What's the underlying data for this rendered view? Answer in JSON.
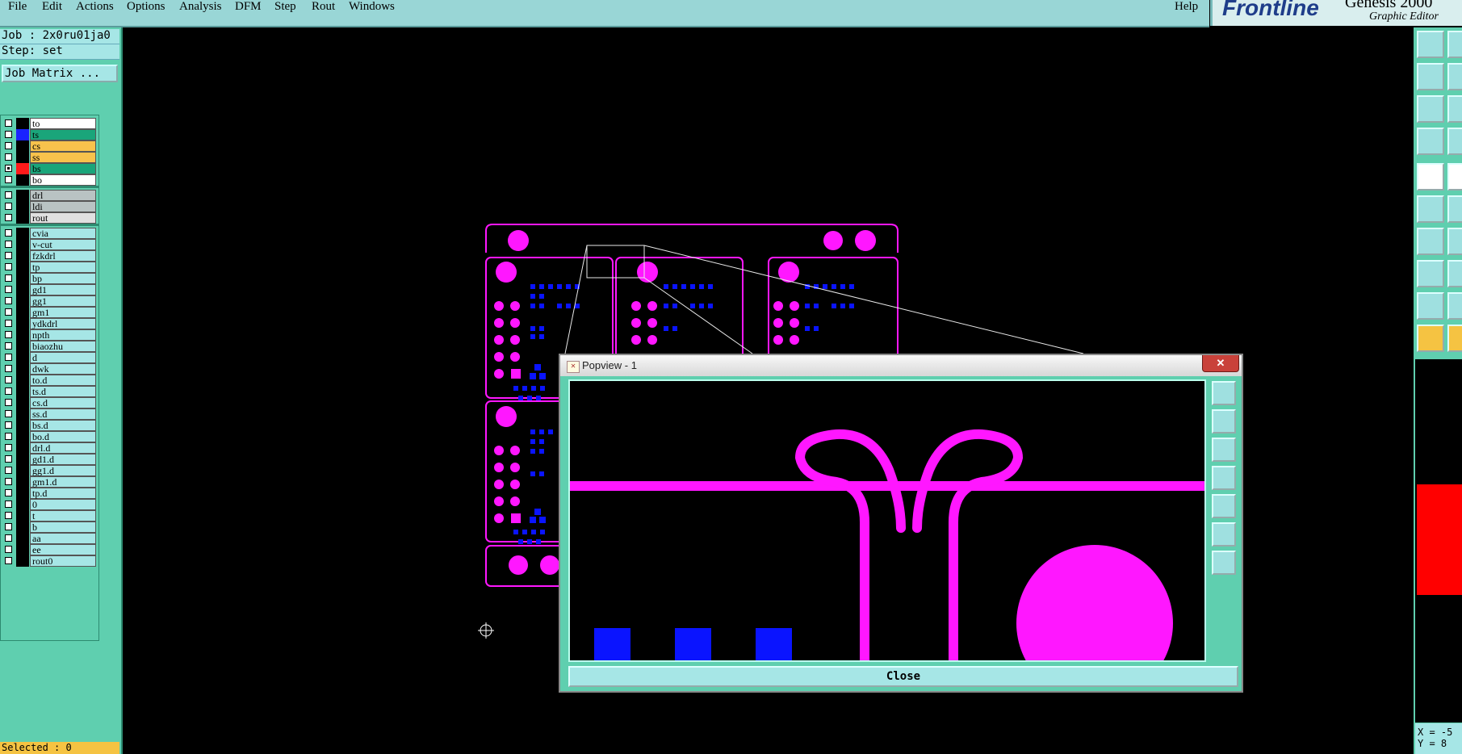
{
  "menubar": {
    "items": [
      "File",
      "Edit",
      "Actions",
      "Options",
      "Analysis",
      "DFM",
      "Step",
      "Rout",
      "Windows"
    ],
    "help": "Help"
  },
  "brand": {
    "logo": "Frontline",
    "title": "Genesis 2000",
    "subtitle": "Graphic Editor"
  },
  "job": {
    "job_line": "Job : 2x0ru01ja0",
    "step_line": "Step: set",
    "matrix_button": "Job Matrix ..."
  },
  "layers": [
    {
      "name": "to",
      "bg": "#ffffff",
      "color": "#000000",
      "checked": false
    },
    {
      "name": "ts",
      "bg": "#1aa57a",
      "color": "#1a23ff",
      "checked": false
    },
    {
      "name": "cs",
      "bg": "#f8c24c",
      "color": "#000000",
      "checked": false
    },
    {
      "name": "ss",
      "bg": "#f8c24c",
      "color": "#000000",
      "checked": false
    },
    {
      "name": "bs",
      "bg": "#1aa57a",
      "color": "#ff1a1a",
      "checked": true
    },
    {
      "name": "bo",
      "bg": "#ffffff",
      "color": "#000000",
      "checked": false
    },
    {
      "name": "drl",
      "bg": "#b9c3c3",
      "color": "#000000",
      "checked": false
    },
    {
      "name": "ldi",
      "bg": "#b9c3c3",
      "color": "#000000",
      "checked": false
    },
    {
      "name": "rout",
      "bg": "#e0e0e0",
      "color": "#000000",
      "checked": false
    },
    {
      "name": "cvia",
      "bg": "#a6e6e6",
      "color": "#000000",
      "checked": false
    },
    {
      "name": "v-cut",
      "bg": "#a6e6e6",
      "color": "#000000",
      "checked": false
    },
    {
      "name": "fzkdrl",
      "bg": "#a6e6e6",
      "color": "#000000",
      "checked": false
    },
    {
      "name": "tp",
      "bg": "#a6e6e6",
      "color": "#000000",
      "checked": false
    },
    {
      "name": "bp",
      "bg": "#a6e6e6",
      "color": "#000000",
      "checked": false
    },
    {
      "name": "gd1",
      "bg": "#a6e6e6",
      "color": "#000000",
      "checked": false
    },
    {
      "name": "gg1",
      "bg": "#a6e6e6",
      "color": "#000000",
      "checked": false
    },
    {
      "name": "gm1",
      "bg": "#a6e6e6",
      "color": "#000000",
      "checked": false
    },
    {
      "name": "ydkdrl",
      "bg": "#a6e6e6",
      "color": "#000000",
      "checked": false
    },
    {
      "name": "npth",
      "bg": "#a6e6e6",
      "color": "#000000",
      "checked": false
    },
    {
      "name": "biaozhu",
      "bg": "#a6e6e6",
      "color": "#000000",
      "checked": false
    },
    {
      "name": "d",
      "bg": "#a6e6e6",
      "color": "#000000",
      "checked": false
    },
    {
      "name": "dwk",
      "bg": "#a6e6e6",
      "color": "#000000",
      "checked": false
    },
    {
      "name": "to.d",
      "bg": "#a6e6e6",
      "color": "#000000",
      "checked": false
    },
    {
      "name": "ts.d",
      "bg": "#a6e6e6",
      "color": "#000000",
      "checked": false
    },
    {
      "name": "cs.d",
      "bg": "#a6e6e6",
      "color": "#000000",
      "checked": false
    },
    {
      "name": "ss.d",
      "bg": "#a6e6e6",
      "color": "#000000",
      "checked": false
    },
    {
      "name": "bs.d",
      "bg": "#a6e6e6",
      "color": "#000000",
      "checked": false
    },
    {
      "name": "bo.d",
      "bg": "#a6e6e6",
      "color": "#000000",
      "checked": false
    },
    {
      "name": "drl.d",
      "bg": "#a6e6e6",
      "color": "#000000",
      "checked": false
    },
    {
      "name": "gd1.d",
      "bg": "#a6e6e6",
      "color": "#000000",
      "checked": false
    },
    {
      "name": "gg1.d",
      "bg": "#a6e6e6",
      "color": "#000000",
      "checked": false
    },
    {
      "name": "gm1.d",
      "bg": "#a6e6e6",
      "color": "#000000",
      "checked": false
    },
    {
      "name": "tp.d",
      "bg": "#a6e6e6",
      "color": "#000000",
      "checked": false
    },
    {
      "name": "0",
      "bg": "#a6e6e6",
      "color": "#000000",
      "checked": false
    },
    {
      "name": "t",
      "bg": "#a6e6e6",
      "color": "#000000",
      "checked": false
    },
    {
      "name": "b",
      "bg": "#a6e6e6",
      "color": "#000000",
      "checked": false
    },
    {
      "name": "aa",
      "bg": "#a6e6e6",
      "color": "#000000",
      "checked": false
    },
    {
      "name": "ee",
      "bg": "#a6e6e6",
      "color": "#000000",
      "checked": false
    },
    {
      "name": "rout0",
      "bg": "#a6e6e6",
      "color": "#000000",
      "checked": false
    }
  ],
  "status": {
    "selected": "Selected : 0",
    "x_readout": "X = -5",
    "y_readout": "Y = 8"
  },
  "popview": {
    "title": "Popview - 1",
    "close_x": "✕",
    "close_button": "Close"
  },
  "colors": {
    "accent": "#5fcfaf",
    "panel": "#a6e6e6",
    "pad_magenta": "#ff17ff",
    "pad_blue": "#0a14ff"
  }
}
